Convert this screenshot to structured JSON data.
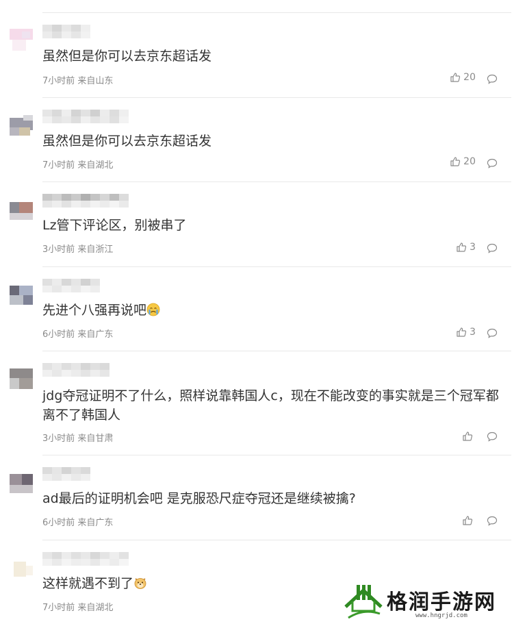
{
  "comments": [
    {
      "text": "虽然但是你可以去京东超话发",
      "time": "7小时前",
      "location": "来自山东",
      "likes": "20"
    },
    {
      "text": "虽然但是你可以去京东超话发",
      "time": "7小时前",
      "location": "来自湖北",
      "likes": "20"
    },
    {
      "text": "Lz管下评论区，别被串了",
      "time": "3小时前",
      "location": "来自浙江",
      "likes": "3"
    },
    {
      "text": "先进个八强再说吧",
      "time": "6小时前",
      "location": "来自广东",
      "likes": "3",
      "emoji": "crying-face"
    },
    {
      "text": "jdg夺冠证明不了什么，照样说靠韩国人c，现在不能改变的事实就是三个冠军都离不了韩国人",
      "time": "3小时前",
      "location": "来自甘肃",
      "likes": ""
    },
    {
      "text": "ad最后的证明机会吧 是克服恐尺症夺冠还是继续被擒?",
      "time": "6小时前",
      "location": "来自广东",
      "likes": ""
    },
    {
      "text": "这样就遇不到了",
      "time": "7小时前",
      "location": "来自湖北",
      "likes": "",
      "emoji": "doge"
    }
  ],
  "watermark": {
    "title": "格润手游网",
    "url": "www.hngrjd.com"
  },
  "colors": {
    "text": "#333333",
    "meta": "#8a8a8a",
    "divider": "#e8e8e8",
    "logo_green": "#3a9a2a"
  }
}
